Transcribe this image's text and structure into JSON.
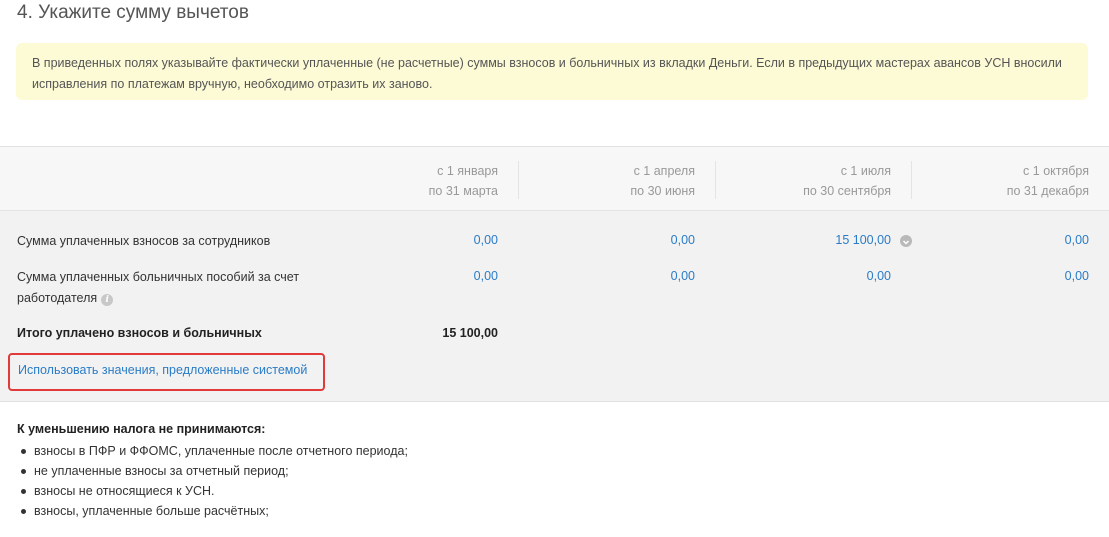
{
  "step": {
    "title": "4. Укажите сумму вычетов"
  },
  "notice": {
    "text": "В приведенных полях указывайте фактически уплаченные (не расчетные) суммы взносов и больничных из вкладки Деньги. Если в предыдущих мастерах авансов УСН вносили исправления по платежам вручную, необходимо отразить их заново."
  },
  "periods": [
    {
      "from": "с 1 января",
      "to": "по 31 марта"
    },
    {
      "from": "с 1 апреля",
      "to": "по 30 июня"
    },
    {
      "from": "с 1 июля",
      "to": "по 30 сентября"
    },
    {
      "from": "с 1 октября",
      "to": "по 31 декабря"
    }
  ],
  "rows": [
    {
      "label": "Сумма уплаченных взносов за сотрудников",
      "values": [
        "0,00",
        "0,00",
        "15 100,00",
        "0,00"
      ],
      "icon": "chevron-down-icon"
    },
    {
      "label_line1": "Сумма уплаченных больничных пособий за счет",
      "label_line2": "работодателя",
      "values": [
        "0,00",
        "0,00",
        "0,00",
        "0,00"
      ],
      "icon": "info-icon"
    }
  ],
  "total": {
    "label": "Итого уплачено взносов и больничных",
    "value": "15 100,00"
  },
  "suggest": {
    "label": "Использовать значения, предложенные системой"
  },
  "exclusions": {
    "title": "К уменьшению налога не принимаются:",
    "items": [
      "взносы в ПФР и ФФОМС, уплаченные после отчетного периода;",
      "не уплаченные взносы за отчетный период;",
      "взносы не относящиеся к УСН.",
      "взносы, уплаченные больше расчётных;"
    ]
  },
  "colors": {
    "link": "#2a7cc7",
    "highlight_border": "#e03a3a",
    "notice_bg": "#fdfbd6"
  }
}
